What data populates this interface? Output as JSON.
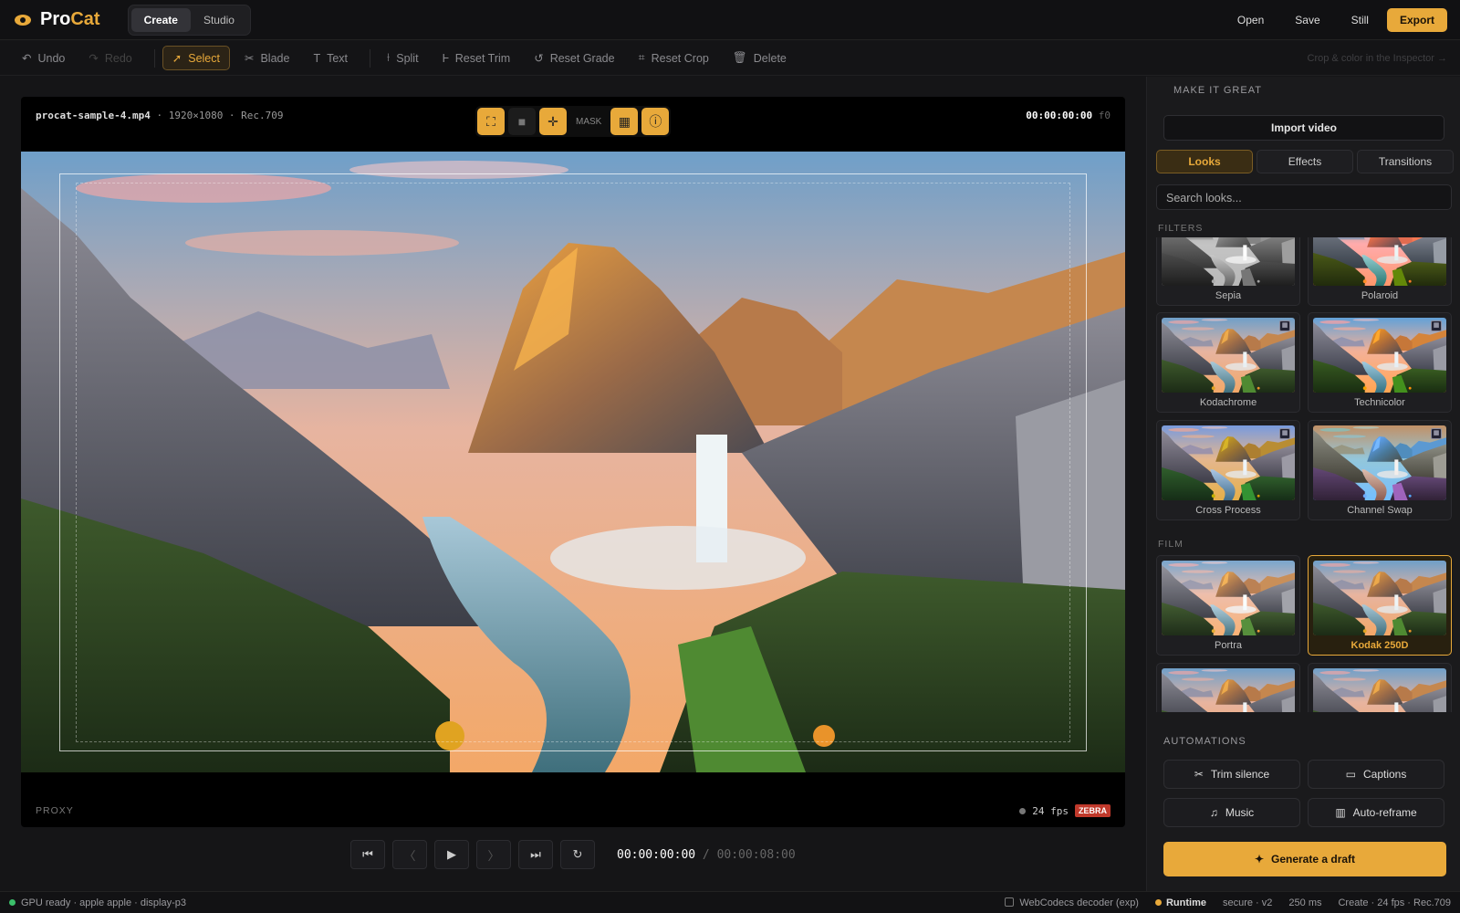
{
  "app": {
    "name_pro": "Pro",
    "name_cat": "Cat"
  },
  "modes": [
    {
      "label": "Create",
      "active": true
    },
    {
      "label": "Studio",
      "active": false
    }
  ],
  "top_actions": {
    "open": "Open",
    "save": "Save",
    "still": "Still",
    "export": "Export"
  },
  "toolbar": {
    "undo": "Undo",
    "redo": "Redo",
    "select": "Select",
    "blade": "Blade",
    "text": "Text",
    "split": "Split",
    "reset_trim": "Reset Trim",
    "reset_grade": "Reset Grade",
    "reset_crop": "Reset Crop",
    "delete": "Delete",
    "hint": "Crop & color in the Inspector →"
  },
  "viewer": {
    "filename": "procat-sample-4.mp4",
    "meta": " · 1920×1080 · Rec.709",
    "timecode": "00:00:00:00",
    "frame": "f0",
    "mask_label": "MASK",
    "proxy": "PROXY",
    "fps": "24 fps",
    "zebra": "ZEBRA"
  },
  "transport": {
    "current": "00:00:00:00",
    "separator": " / ",
    "total": "00:00:08:00"
  },
  "panel": {
    "header": "MAKE IT GREAT",
    "import": "Import video",
    "tabs": [
      "Looks",
      "Effects",
      "Transitions"
    ],
    "search_placeholder": "Search looks...",
    "filters_label": "FILTERS",
    "filters": [
      "Sepia",
      "Polaroid",
      "Kodachrome",
      "Technicolor",
      "Cross Process",
      "Channel Swap"
    ],
    "film_label": "FILM",
    "film": [
      "Portra",
      "Kodak 250D"
    ],
    "selected_look": "Kodak 250D",
    "automations_label": "AUTOMATIONS",
    "automations": [
      "Trim silence",
      "Captions",
      "Music",
      "Auto-reframe"
    ],
    "generate": "Generate a draft"
  },
  "status": {
    "left": "GPU ready · apple apple · display-p3",
    "decoder": "WebCodecs decoder (exp)",
    "runtime": "Runtime",
    "secure": "secure · v2",
    "latency": "250 ms",
    "summary": "Create · 24 fps · Rec.709"
  },
  "colors": {
    "accent": "#e8a93a",
    "background": "#151517",
    "panel": "#1a1a1c",
    "zebra": "#c0392b",
    "gpu_ok": "#3bbf6a"
  }
}
